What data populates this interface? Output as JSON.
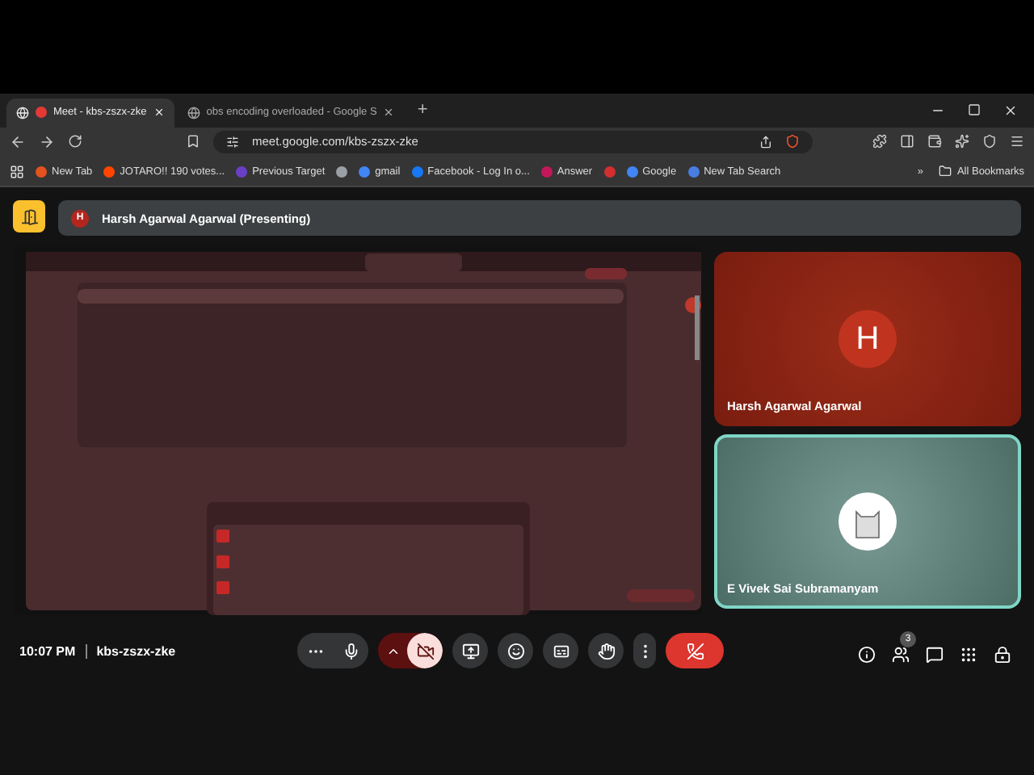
{
  "browser": {
    "tabs": [
      {
        "title": "Meet - kbs-zszx-zke",
        "selected": true,
        "recording": true
      },
      {
        "title": "obs encoding overloaded - Google S",
        "selected": false,
        "recording": false
      }
    ],
    "new_tab": "+",
    "url": "meet.google.com/kbs-zszx-zke",
    "bookmarks": [
      {
        "kind": "brave",
        "label": "New Tab"
      },
      {
        "kind": "reddit",
        "label": "JOTARO!! 190 votes..."
      },
      {
        "kind": "purple",
        "label": "Previous Target"
      },
      {
        "kind": "globe"
      },
      {
        "kind": "google",
        "label": "gmail"
      },
      {
        "kind": "facebook",
        "label": "Facebook - Log In o..."
      },
      {
        "kind": "answer",
        "label": "Answer"
      },
      {
        "kind": "tm"
      },
      {
        "kind": "google",
        "label": "Google"
      },
      {
        "kind": "sync",
        "label": "New Tab Search"
      }
    ],
    "overflow": "»",
    "all_bookmarks": "All Bookmarks"
  },
  "meet": {
    "presenter": {
      "initial": "H",
      "label": "Harsh Agarwal Agarwal (Presenting)"
    },
    "participants": [
      {
        "name": "Harsh Agarwal Agarwal",
        "kind": "initial",
        "initial": "H",
        "highlighted": false
      },
      {
        "name": "E Vivek Sai Subramanyam",
        "highlighted": true
      }
    ],
    "time": "10:07 PM",
    "meeting_code": "kbs-zszx-zke",
    "controls": [
      {
        "kind": "reactions"
      },
      {
        "kind": "mic",
        "muted": false
      },
      {
        "kind": "camera",
        "muted": true
      },
      {
        "kind": "present"
      },
      {
        "kind": "emoji"
      },
      {
        "kind": "captions"
      },
      {
        "kind": "hand"
      },
      {
        "kind": "more"
      },
      {
        "kind": "leave"
      }
    ],
    "side_buttons": [
      {
        "kind": "info"
      },
      {
        "kind": "people",
        "badge": "3"
      },
      {
        "kind": "chat"
      },
      {
        "kind": "activities"
      },
      {
        "kind": "lock"
      }
    ]
  }
}
